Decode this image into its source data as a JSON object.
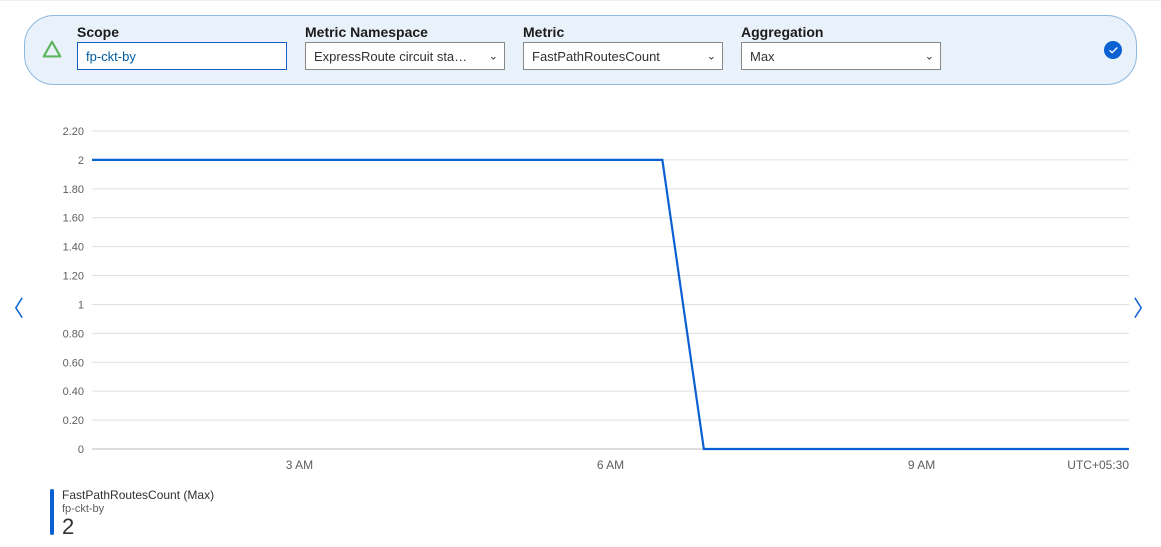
{
  "filters": {
    "scope": {
      "label": "Scope",
      "value": "fp-ckt-by"
    },
    "metric_namespace": {
      "label": "Metric Namespace",
      "value": "ExpressRoute circuit sta…"
    },
    "metric": {
      "label": "Metric",
      "value": "FastPathRoutesCount"
    },
    "aggregation": {
      "label": "Aggregation",
      "value": "Max"
    }
  },
  "legend": {
    "metric": "FastPathRoutesCount (Max)",
    "scope": "fp-ckt-by",
    "value": "2"
  },
  "timezone": "UTC+05:30",
  "chart_data": {
    "type": "line",
    "xlabel": "",
    "ylabel": "",
    "ylim": [
      0,
      2.2
    ],
    "x_ticks": [
      "3 AM",
      "6 AM",
      "9 AM"
    ],
    "y_ticks": [
      0,
      0.2,
      0.4,
      0.6,
      0.8,
      1,
      1.2,
      1.4,
      1.6,
      1.8,
      2,
      2.2
    ],
    "x_range_hours": [
      1,
      11
    ],
    "series": [
      {
        "name": "FastPathRoutesCount (Max)",
        "x_hours": [
          1.0,
          6.5,
          6.9,
          11.0
        ],
        "values": [
          2,
          2,
          0,
          0
        ]
      }
    ]
  }
}
